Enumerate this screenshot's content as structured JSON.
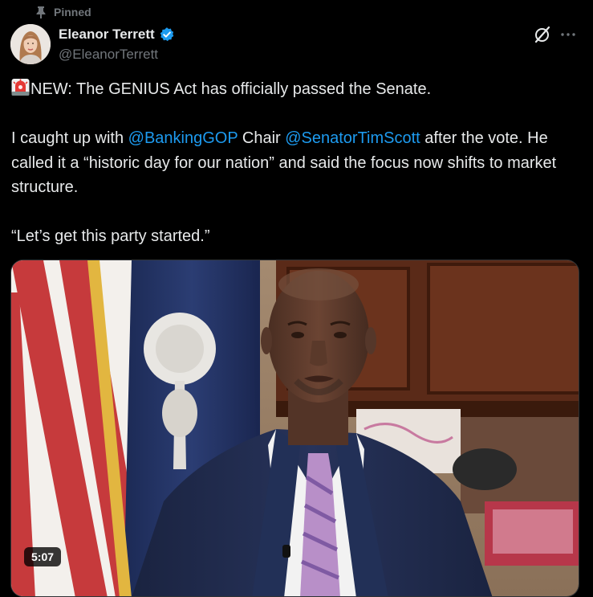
{
  "pinned_label": "Pinned",
  "author": {
    "name": "Eleanor Terrett",
    "handle": "@EleanorTerrett"
  },
  "tweet": {
    "line1": "NEW: The GENIUS Act has officially passed the Senate.",
    "p2_before": "I caught up with ",
    "mention1": "@BankingGOP",
    "p2_middle": " Chair ",
    "mention2": "@SenatorTimScott",
    "p2_after": " after the vote. He called it a “historic day for our nation” and said the focus now shifts to market structure.",
    "quote": "“Let’s get this party started.”"
  },
  "video": {
    "duration": "5:07"
  },
  "icons": {
    "pin": "pin-icon",
    "verified": "verified-badge-icon",
    "grok": "grok-icon",
    "more": "more-icon",
    "siren": "siren-icon"
  },
  "colors": {
    "background": "#000000",
    "text": "#e7e9ea",
    "secondary": "#71767b",
    "link": "#1d9bf0",
    "verified": "#1d9bf0"
  }
}
